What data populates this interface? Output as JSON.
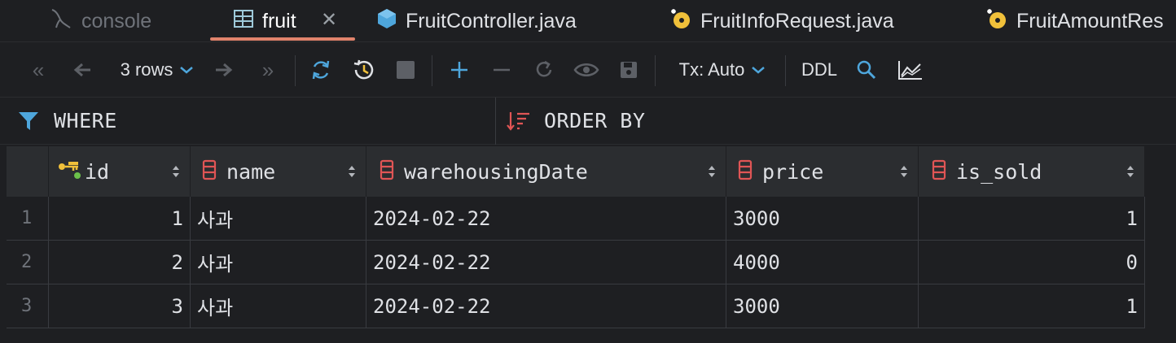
{
  "tabs": [
    {
      "label": "console",
      "icon": "mysql-dolphin-icon",
      "active": false
    },
    {
      "label": "fruit",
      "icon": "table-icon",
      "active": true
    },
    {
      "label": "FruitController.java",
      "icon": "java-class-icon",
      "active": false
    },
    {
      "label": "FruitInfoRequest.java",
      "icon": "java-record-icon",
      "active": false
    },
    {
      "label": "FruitAmountRes",
      "icon": "java-record-icon",
      "active": false
    }
  ],
  "toolbar": {
    "rows_label": "3 rows",
    "tx_label": "Tx: Auto",
    "ddl_label": "DDL"
  },
  "filters": {
    "where_label": "WHERE",
    "order_label": "ORDER BY"
  },
  "table": {
    "columns": [
      {
        "name": "id",
        "icon": "primary-key-icon"
      },
      {
        "name": "name",
        "icon": "column-icon"
      },
      {
        "name": "warehousingDate",
        "icon": "column-icon"
      },
      {
        "name": "price",
        "icon": "column-icon"
      },
      {
        "name": "is_sold",
        "icon": "column-icon"
      }
    ],
    "rows": [
      {
        "num": "1",
        "id": "1",
        "name": "사과",
        "warehousingDate": "2024-02-22",
        "price": "3000",
        "is_sold": "1"
      },
      {
        "num": "2",
        "id": "2",
        "name": "사과",
        "warehousingDate": "2024-02-22",
        "price": "4000",
        "is_sold": "0"
      },
      {
        "num": "3",
        "id": "3",
        "name": "사과",
        "warehousingDate": "2024-02-22",
        "price": "3000",
        "is_sold": "1"
      }
    ]
  },
  "colors": {
    "accent_tab": "#e0836c",
    "icon_blue": "#4ea6dc",
    "icon_red": "#e05555",
    "icon_yellow": "#f0c03a"
  }
}
